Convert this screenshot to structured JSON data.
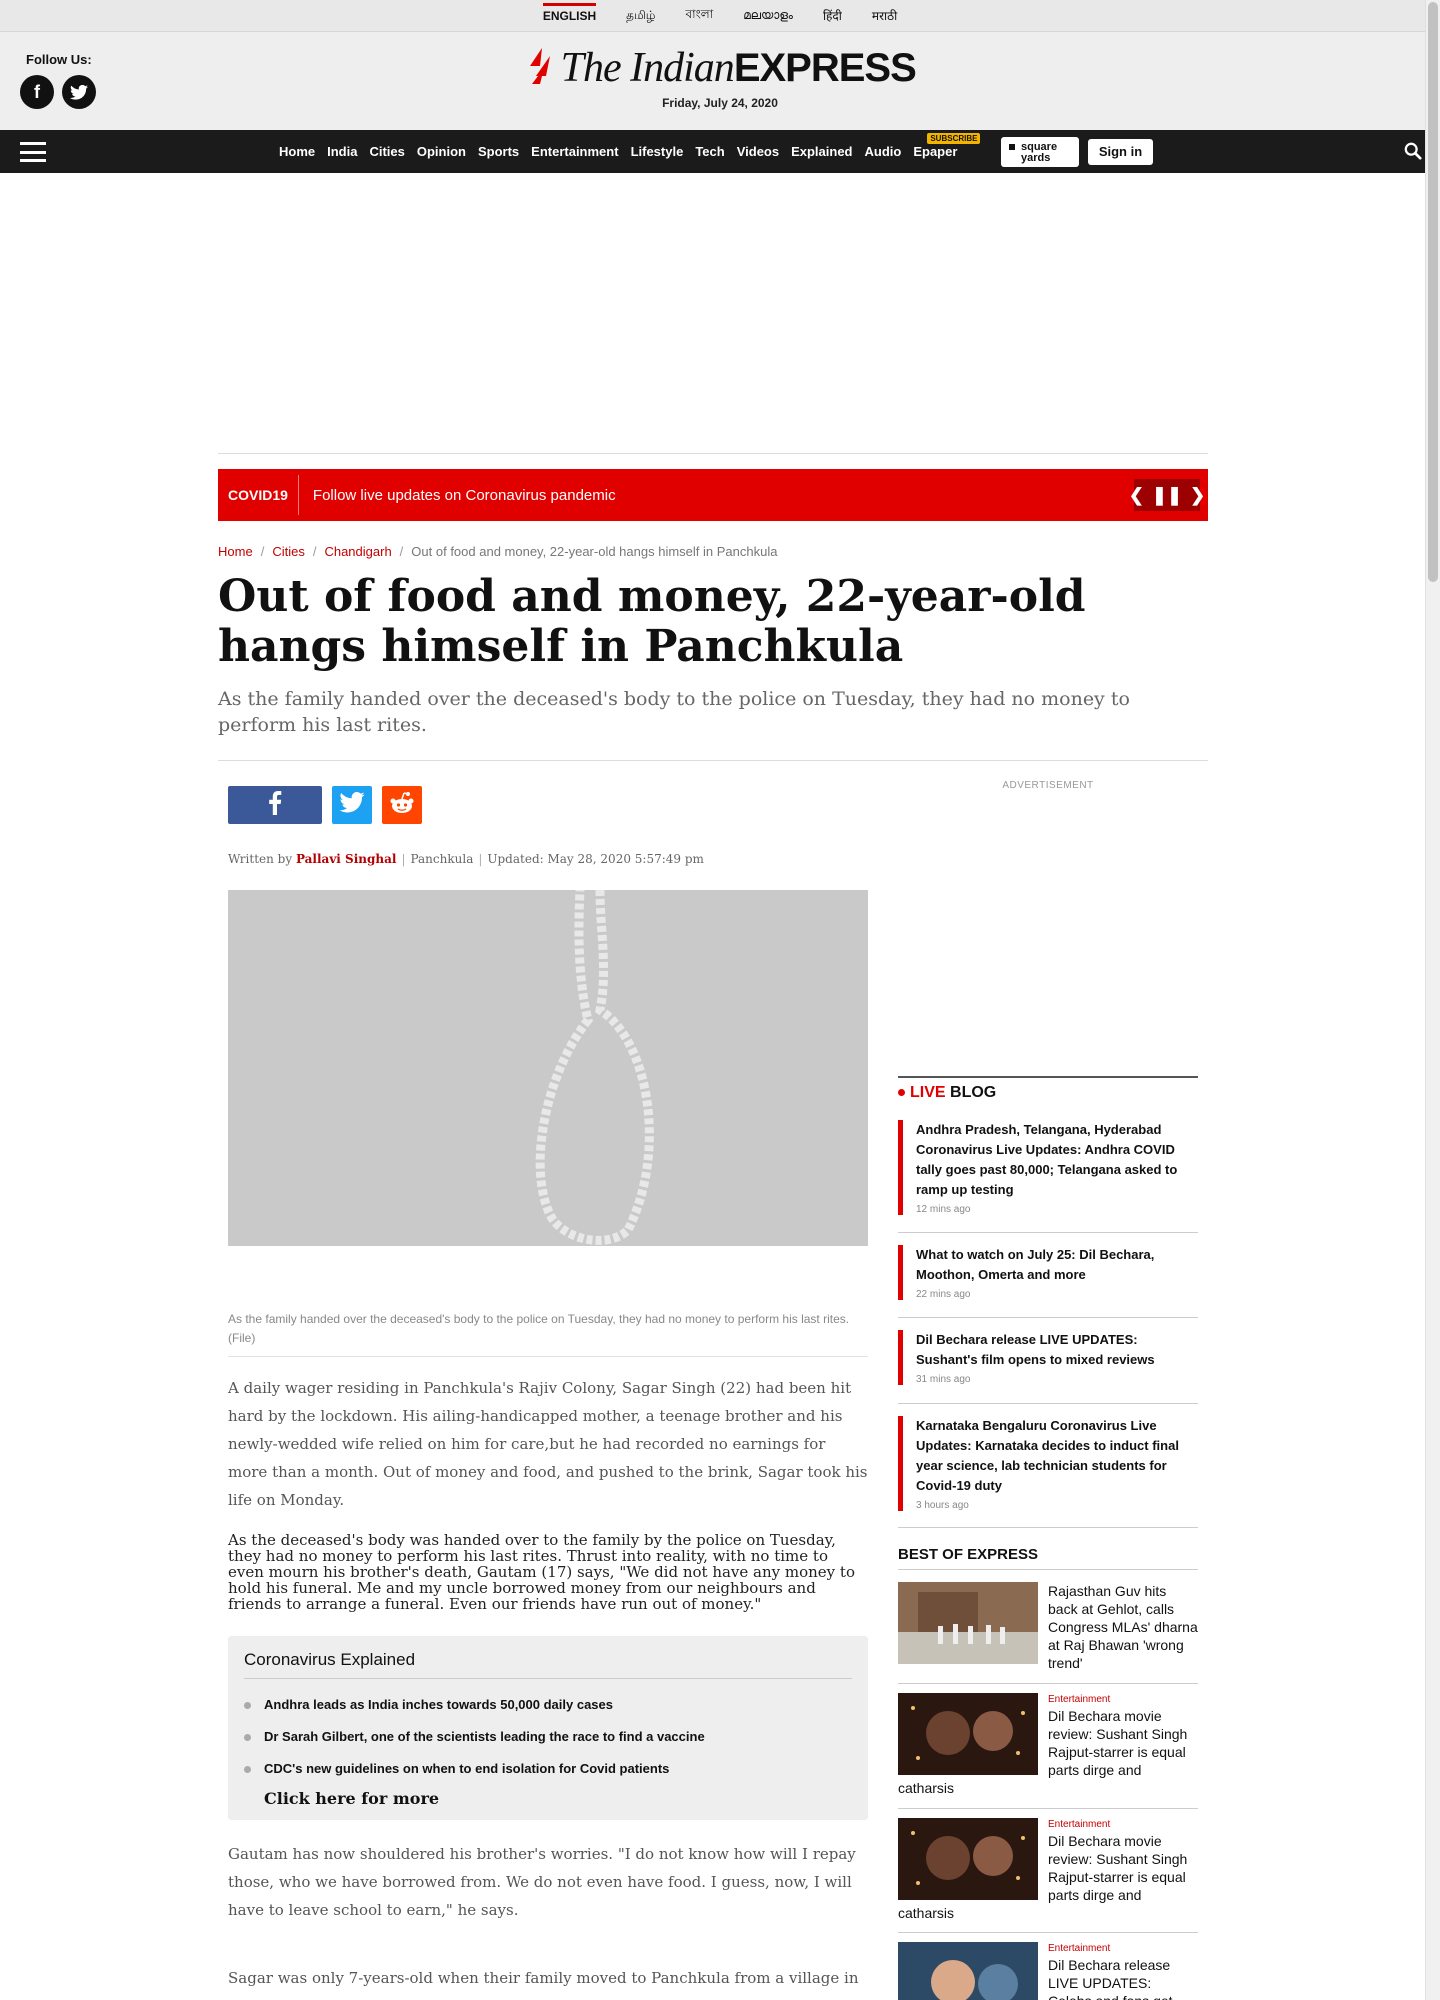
{
  "languages": [
    "ENGLISH",
    "தமிழ்",
    "বাংলা",
    "മലയാളം",
    "हिंदी",
    "मराठी"
  ],
  "masthead": {
    "follow_label": "Follow Us:",
    "logo_the": "The Indian",
    "logo_express": "EXPRESS",
    "date": "Friday, July 24, 2020"
  },
  "nav": {
    "items": [
      "Home",
      "India",
      "Cities",
      "Opinion",
      "Sports",
      "Entertainment",
      "Lifestyle",
      "Tech",
      "Videos",
      "Explained",
      "Audio",
      "Epaper"
    ],
    "subscribe_badge": "SUBSCRIBE",
    "square_yards_top": "square",
    "square_yards_bottom": "yards",
    "signin": "Sign in"
  },
  "covid_bar": {
    "tag": "COVID19",
    "text": "Follow live updates on Coronavirus pandemic"
  },
  "breadcrumbs": [
    "Home",
    "Cities",
    "Chandigarh",
    "Out of food and money, 22-year-old hangs himself in Panchkula"
  ],
  "article": {
    "headline": "Out of food and money, 22-year-old hangs himself in Panchkula",
    "synopsis": "As the family handed over the deceased's body to the police on Tuesday, they had no money to perform his last rites.",
    "byline_prefix": "Written by",
    "author": "Pallavi Singhal",
    "location": "Panchkula",
    "updated": "Updated: May 28, 2020 5:57:49 pm",
    "caption": "As the family handed over the deceased's body to the police on Tuesday, they had no money to perform his last rites. (File)",
    "para1": "A daily wager residing in Panchkula's Rajiv Colony, Sagar Singh (22) had been hit hard by the lockdown. His ailing-handicapped mother, a teenage brother and his newly-wedded wife relied on him for care,but he had recorded no earnings for more than a month. Out of money and food, and pushed to the brink, Sagar took his life on Monday.",
    "para2": "As the deceased's body was handed over to the family by the police on Tuesday, they had no money to perform his last rites. Thrust into reality, with no time to even mourn his brother's death, Gautam (17) says, \"We did not have any money to hold his funeral. Me and my uncle borrowed money from our neighbours and friends to arrange a funeral. Even our friends have run out of money.\"",
    "para3": "Gautam has now shouldered his brother's worries. \"I do not know how will I repay those, who we have borrowed from. We do not even have food. I guess, now, I will have to leave school to earn,\" he says.",
    "para4": "Sagar was only 7-years-old when their family moved to Panchkula from a village in"
  },
  "explained_box": {
    "title": "Coronavirus Explained",
    "items": [
      "Andhra leads as India inches towards 50,000 daily cases",
      "Dr Sarah Gilbert, one of the scientists leading the race to find a vaccine",
      "CDC's new guidelines on when to end isolation for Covid patients"
    ],
    "more": "Click here for more"
  },
  "sidebar": {
    "ad_label": "ADVERTISEMENT",
    "live_label": "LIVE",
    "blog_label": "BLOG",
    "live_items": [
      {
        "title": "Andhra Pradesh, Telangana, Hyderabad Coronavirus Live Updates: Andhra COVID tally goes past 80,000; Telangana asked to ramp up testing",
        "time": "12 mins ago"
      },
      {
        "title": "What to watch on July 25: Dil Bechara, Moothon, Omerta and more",
        "time": "22 mins ago"
      },
      {
        "title": "Dil Bechara release LIVE UPDATES: Sushant's film opens to mixed reviews",
        "time": "31 mins ago"
      },
      {
        "title": "Karnataka Bengaluru Coronavirus Live Updates: Karnataka decides to induct final year science, lab technician students for Covid-19 duty",
        "time": "3 hours ago"
      }
    ],
    "best_label": "BEST OF EXPRESS",
    "best_items": [
      {
        "category": "",
        "title": "Rajasthan Guv hits back at Gehlot, calls Congress MLAs' dharna at Raj Bhawan 'wrong trend'"
      },
      {
        "category": "Entertainment",
        "title": "Dil Bechara movie review: Sushant Singh Rajput-starrer is equal parts dirge and catharsis"
      },
      {
        "category": "Entertainment",
        "title": "Dil Bechara movie review: Sushant Singh Rajput-starrer is equal parts dirge and catharsis"
      },
      {
        "category": "Entertainment",
        "title": "Dil Bechara release LIVE UPDATES: Celebs and fans get emotional"
      }
    ]
  },
  "colors": {
    "brand_red": "#e10000",
    "nav_bg": "#1b1b1b",
    "link_red": "#c40000"
  }
}
